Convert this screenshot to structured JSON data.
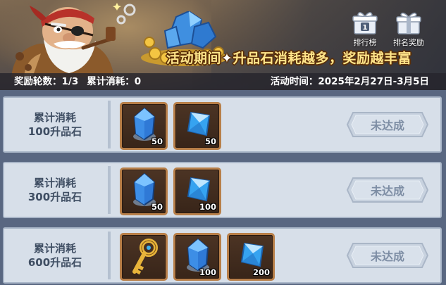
{
  "banner": {
    "slogan_left": "活动期间",
    "slogan_right": "升品石消耗越多，奖励越丰富",
    "ranking_label": "排行榜",
    "rank_reward_label": "排名奖励"
  },
  "info": {
    "round_label": "奖励轮数：",
    "round_value": "1/3",
    "consumed_label": "累计消耗：",
    "consumed_value": "0",
    "time_label": "活动时间：",
    "time_value": "2025年2月27日-3月5日"
  },
  "tiers": [
    {
      "line1": "累计消耗",
      "line2": "100升品石",
      "status": "未达成",
      "rewards": [
        {
          "icon": "blue-stone-icon",
          "qty": "50"
        },
        {
          "icon": "blue-crystal-icon",
          "qty": "50"
        }
      ]
    },
    {
      "line1": "累计消耗",
      "line2": "300升品石",
      "status": "未达成",
      "rewards": [
        {
          "icon": "blue-stone-icon",
          "qty": "50"
        },
        {
          "icon": "blue-crystal-icon",
          "qty": "100"
        }
      ]
    },
    {
      "line1": "累计消耗",
      "line2": "600升品石",
      "status": "未达成",
      "rewards": [
        {
          "icon": "golden-key-icon",
          "qty": ""
        },
        {
          "icon": "blue-stone-icon",
          "qty": "100"
        },
        {
          "icon": "blue-crystal-icon",
          "qty": "200"
        }
      ]
    }
  ],
  "colors": {
    "page_bg": "#596781",
    "row_bg": "#d7dfe9",
    "item_border": "#b87f49",
    "slogan": "#ffe58a",
    "status_text": "#7d8da4"
  }
}
